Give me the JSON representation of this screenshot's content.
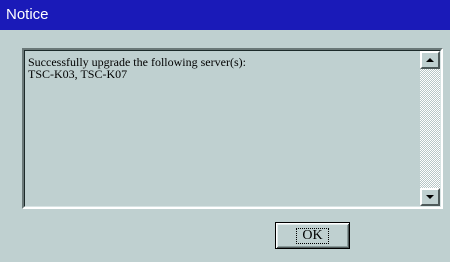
{
  "window": {
    "title": "Notice"
  },
  "message": {
    "text": "Successfully upgrade the following server(s):\nTSC-K03, TSC-K07"
  },
  "buttons": {
    "ok_label": "OK"
  },
  "scrollbar": {
    "up_icon": "arrow-up-icon",
    "down_icon": "arrow-down-icon"
  },
  "colors": {
    "titlebar": "#1a1ab8",
    "dialog_bg": "#bfd0d0"
  }
}
